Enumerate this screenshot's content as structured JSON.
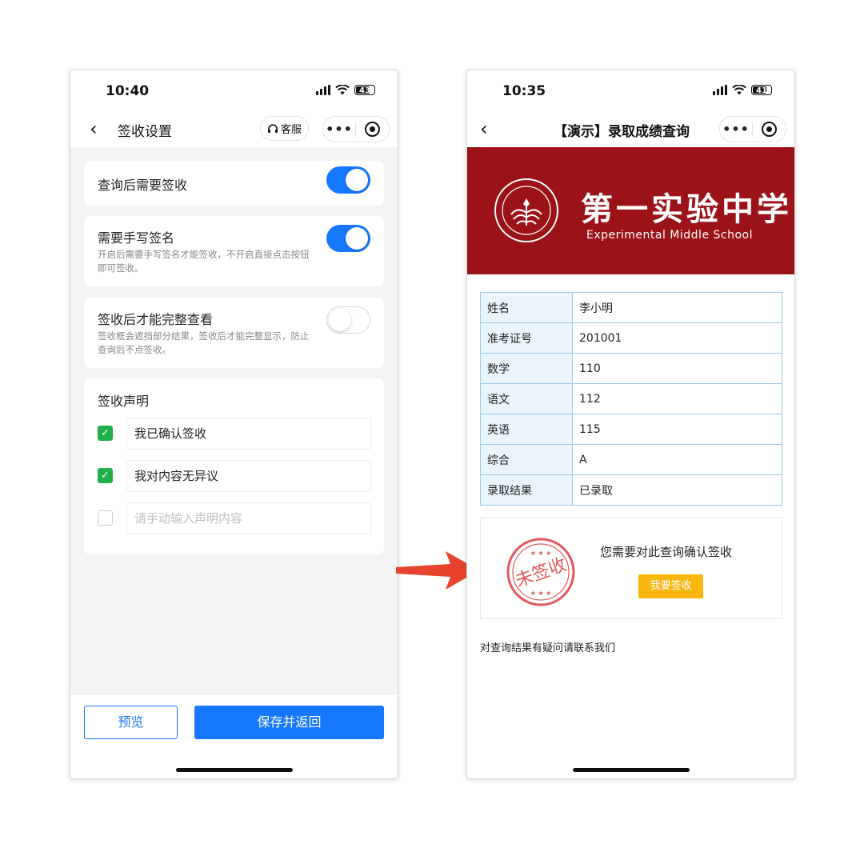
{
  "left_phone": {
    "status": {
      "time": "10:40",
      "battery": "43"
    },
    "nav": {
      "back_icon": "chevron-left-icon",
      "title": "签收设置",
      "service_label": "客服",
      "service_icon": "headset-icon",
      "more_icon": "more-dots-icon",
      "close_icon": "target-circle-icon"
    },
    "settings": [
      {
        "title": "查询后需要签收",
        "desc": "",
        "enabled": true
      },
      {
        "title": "需要手写签名",
        "desc": "开启后需要手写签名才能签收，不开启直接点击按钮即可签收。",
        "enabled": true
      },
      {
        "title": "签收后才能完整查看",
        "desc": "签收框会遮挡部分结果，签收后才能完整显示，防止查询后不点签收。",
        "enabled": false
      }
    ],
    "declaration": {
      "title": "签收声明",
      "items": [
        {
          "checked": true,
          "value": "我已确认签收",
          "placeholder": ""
        },
        {
          "checked": true,
          "value": "我对内容无异议",
          "placeholder": ""
        },
        {
          "checked": false,
          "value": "",
          "placeholder": "请手动输入声明内容"
        }
      ]
    },
    "buttons": {
      "preview": "预览",
      "save": "保存并返回"
    }
  },
  "right_phone": {
    "status": {
      "time": "10:35",
      "battery": "41"
    },
    "nav": {
      "back_icon": "chevron-left-icon",
      "title": "【演示】录取成绩查询",
      "more_icon": "more-dots-icon",
      "close_icon": "target-circle-icon"
    },
    "banner": {
      "school_cn": "第一实验中学",
      "school_en": "Experimental Middle School",
      "color": "#9b1319",
      "emblem_icon": "school-emblem-icon"
    },
    "results": [
      {
        "label": "姓名",
        "value": "李小明"
      },
      {
        "label": "准考证号",
        "value": "201001"
      },
      {
        "label": "数学",
        "value": "110"
      },
      {
        "label": "语文",
        "value": "112"
      },
      {
        "label": "英语",
        "value": "115"
      },
      {
        "label": "综合",
        "value": "A"
      },
      {
        "label": "录取结果",
        "value": "已录取"
      }
    ],
    "sign": {
      "stamp_text": "未签收",
      "prompt": "您需要对此查询确认签收",
      "button": "我要签收"
    },
    "contact": "对查询结果有疑问请联系我们"
  },
  "colors": {
    "primary_blue": "#1677ff",
    "check_green": "#20b04b",
    "banner_red": "#9b1319",
    "sign_button": "#f8b60f",
    "arrow": "#e8432d"
  }
}
